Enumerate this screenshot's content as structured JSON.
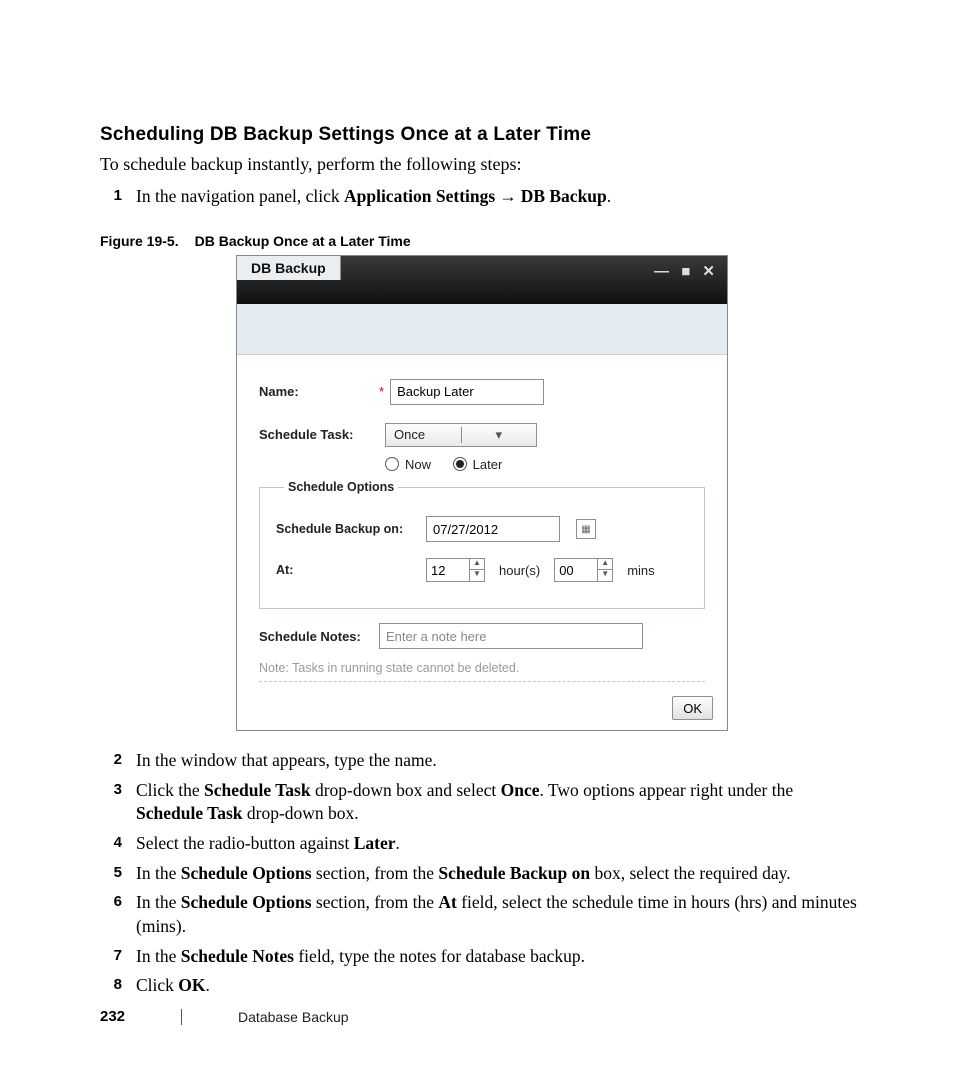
{
  "heading": "Scheduling DB Backup Settings Once at a Later Time",
  "intro": "To schedule backup instantly, perform the following steps:",
  "step1": {
    "n": "1",
    "pre": "In the navigation panel, click ",
    "a": "Application Settings",
    "arrow": "→",
    "b": "DB Backup",
    "post": "."
  },
  "figure": {
    "id": "Figure 19-5.",
    "title": "DB Backup Once at a Later Time"
  },
  "dialog": {
    "title": "DB Backup",
    "winctl": "— ■ ✕",
    "name_label": "Name:",
    "req": "*",
    "name_value": "Backup Later",
    "task_label": "Schedule Task:",
    "task_value": "Once",
    "dd_glyph": "▾",
    "radio_now": "Now",
    "radio_later": "Later",
    "opts_legend": "Schedule Options",
    "date_label": "Schedule Backup on:",
    "date_value": "07/27/2012",
    "cal_glyph": "▦",
    "at_label": "At:",
    "hours": "12",
    "hours_unit": "hour(s)",
    "mins": "00",
    "mins_unit": "mins",
    "up": "▲",
    "down": "▼",
    "notes_label": "Schedule Notes:",
    "notes_value": "Enter a note here",
    "note": "Note: Tasks in running state cannot be deleted.",
    "ok": "OK"
  },
  "step2": {
    "n": "2",
    "txt": "In the window that appears, type the name."
  },
  "step3": {
    "n": "3",
    "pre": "Click the ",
    "a": "Schedule Task",
    "mid": " drop-down box and select ",
    "b": "Once",
    "mid2": ". Two options appear right under the ",
    "c": "Schedule Task",
    "post": " drop-down box."
  },
  "step4": {
    "n": "4",
    "pre": "Select the radio-button against ",
    "a": "Later",
    "post": "."
  },
  "step5": {
    "n": "5",
    "pre": "In the ",
    "a": "Schedule Options",
    "mid": " section, from the ",
    "b": "Schedule Backup on",
    "post": " box, select the required day."
  },
  "step6": {
    "n": "6",
    "pre": "In the ",
    "a": "Schedule Options",
    "mid": " section, from the ",
    "b": "At",
    "post": " field, select the schedule time in hours (hrs) and minutes (mins)."
  },
  "step7": {
    "n": "7",
    "pre": "In the ",
    "a": "Schedule Notes",
    "post": " field, type the notes for database backup."
  },
  "step8": {
    "n": "8",
    "pre": "Click ",
    "a": "OK",
    "post": "."
  },
  "footer": {
    "page": "232",
    "section": "Database Backup"
  }
}
